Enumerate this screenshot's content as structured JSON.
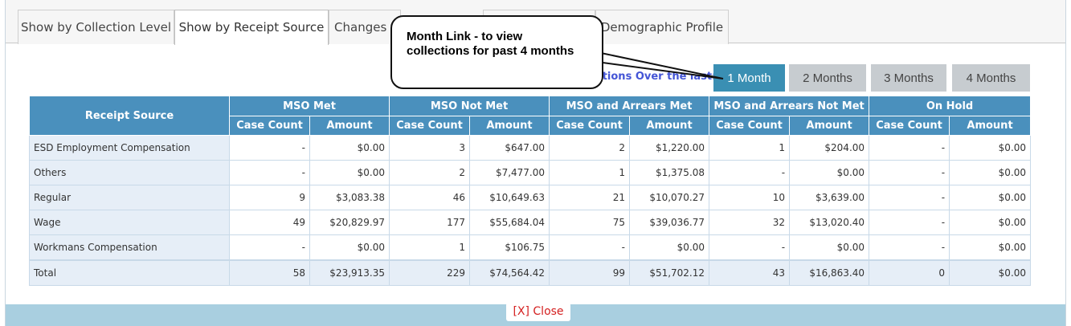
{
  "tabs": [
    {
      "label": "Show by Collection Level",
      "active": false
    },
    {
      "label": "Show by Receipt Source",
      "active": true
    },
    {
      "label": "Changes t",
      "active": false
    },
    {
      "label": "",
      "active": false
    },
    {
      "label": "Demographic Profile",
      "active": false
    }
  ],
  "callout": {
    "line1": "Month Link - to view",
    "line2": "collections for past 4 months"
  },
  "collections_label": "ctions Over the last:",
  "month_buttons": [
    {
      "label": "1 Month",
      "active": true
    },
    {
      "label": "2 Months",
      "active": false
    },
    {
      "label": "3 Months",
      "active": false
    },
    {
      "label": "4 Months",
      "active": false
    }
  ],
  "table": {
    "source_header": "Receipt Source",
    "groups": [
      "MSO Met",
      "MSO Not Met",
      "MSO and Arrears Met",
      "MSO and Arrears Not Met",
      "On Hold"
    ],
    "sub_headers": [
      "Case Count",
      "Amount"
    ],
    "rows": [
      {
        "source": "ESD Employment Compensation",
        "cells": [
          "-",
          "$0.00",
          "3",
          "$647.00",
          "2",
          "$1,220.00",
          "1",
          "$204.00",
          "-",
          "$0.00"
        ]
      },
      {
        "source": "Others",
        "cells": [
          "-",
          "$0.00",
          "2",
          "$7,477.00",
          "1",
          "$1,375.08",
          "-",
          "$0.00",
          "-",
          "$0.00"
        ]
      },
      {
        "source": "Regular",
        "cells": [
          "9",
          "$3,083.38",
          "46",
          "$10,649.63",
          "21",
          "$10,070.27",
          "10",
          "$3,639.00",
          "-",
          "$0.00"
        ]
      },
      {
        "source": "Wage",
        "cells": [
          "49",
          "$20,829.97",
          "177",
          "$55,684.04",
          "75",
          "$39,036.77",
          "32",
          "$13,020.40",
          "-",
          "$0.00"
        ]
      },
      {
        "source": "Workmans Compensation",
        "cells": [
          "-",
          "$0.00",
          "1",
          "$106.75",
          "-",
          "$0.00",
          "-",
          "$0.00",
          "-",
          "$0.00"
        ]
      }
    ],
    "total": {
      "source": "Total",
      "cells": [
        "58",
        "$23,913.35",
        "229",
        "$74,564.42",
        "99",
        "$51,702.12",
        "43",
        "$16,863.40",
        "0",
        "$0.00"
      ]
    }
  },
  "footer": {
    "close_label": "[X] Close"
  }
}
